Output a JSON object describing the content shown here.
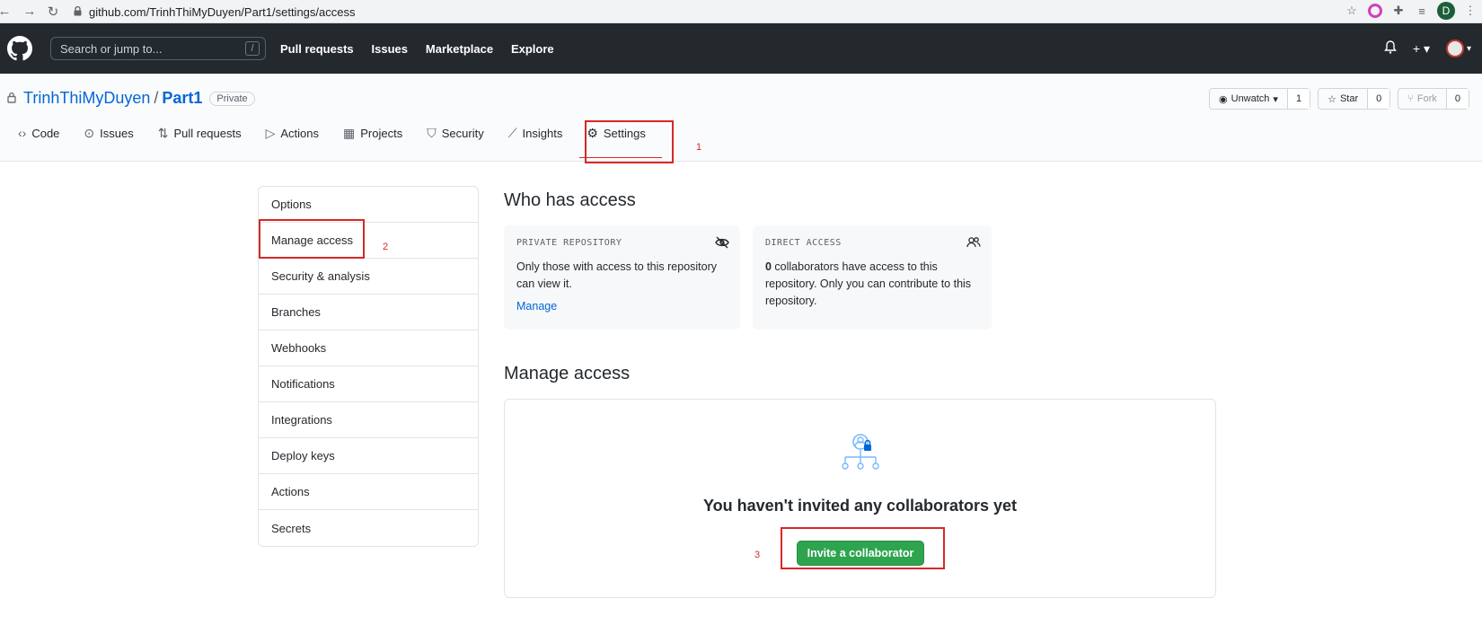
{
  "browser": {
    "url": "github.com/TrinhThiMyDuyen/Part1/settings/access",
    "profile_initial": "D"
  },
  "header": {
    "search_placeholder": "Search or jump to...",
    "search_shortcut": "/",
    "nav": [
      "Pull requests",
      "Issues",
      "Marketplace",
      "Explore"
    ]
  },
  "repo": {
    "owner": "TrinhThiMyDuyen",
    "separator": "/",
    "name": "Part1",
    "visibility": "Private",
    "watch_label": "Unwatch",
    "watch_count": "1",
    "star_label": "Star",
    "star_count": "0",
    "fork_label": "Fork",
    "fork_count": "0"
  },
  "tabs": [
    "Code",
    "Issues",
    "Pull requests",
    "Actions",
    "Projects",
    "Security",
    "Insights",
    "Settings"
  ],
  "active_tab": "Settings",
  "sidebar": {
    "items": [
      "Options",
      "Manage access",
      "Security & analysis",
      "Branches",
      "Webhooks",
      "Notifications",
      "Integrations",
      "Deploy keys",
      "Actions",
      "Secrets"
    ]
  },
  "who_has_access": {
    "title": "Who has access",
    "private_card": {
      "kicker": "PRIVATE REPOSITORY",
      "text": "Only those with access to this repository can view it.",
      "link": "Manage"
    },
    "direct_card": {
      "kicker": "DIRECT ACCESS",
      "count": "0",
      "text": " collaborators have access to this repository. Only you can contribute to this repository."
    }
  },
  "manage_access": {
    "title": "Manage access",
    "empty_message": "You haven't invited any collaborators yet",
    "invite_button": "Invite a collaborator"
  },
  "annotations": [
    "1",
    "2",
    "3"
  ],
  "colors": {
    "header_bg": "#24292e",
    "link": "#0366d6",
    "primary_button": "#2ea44f",
    "annotation": "#d62828"
  }
}
